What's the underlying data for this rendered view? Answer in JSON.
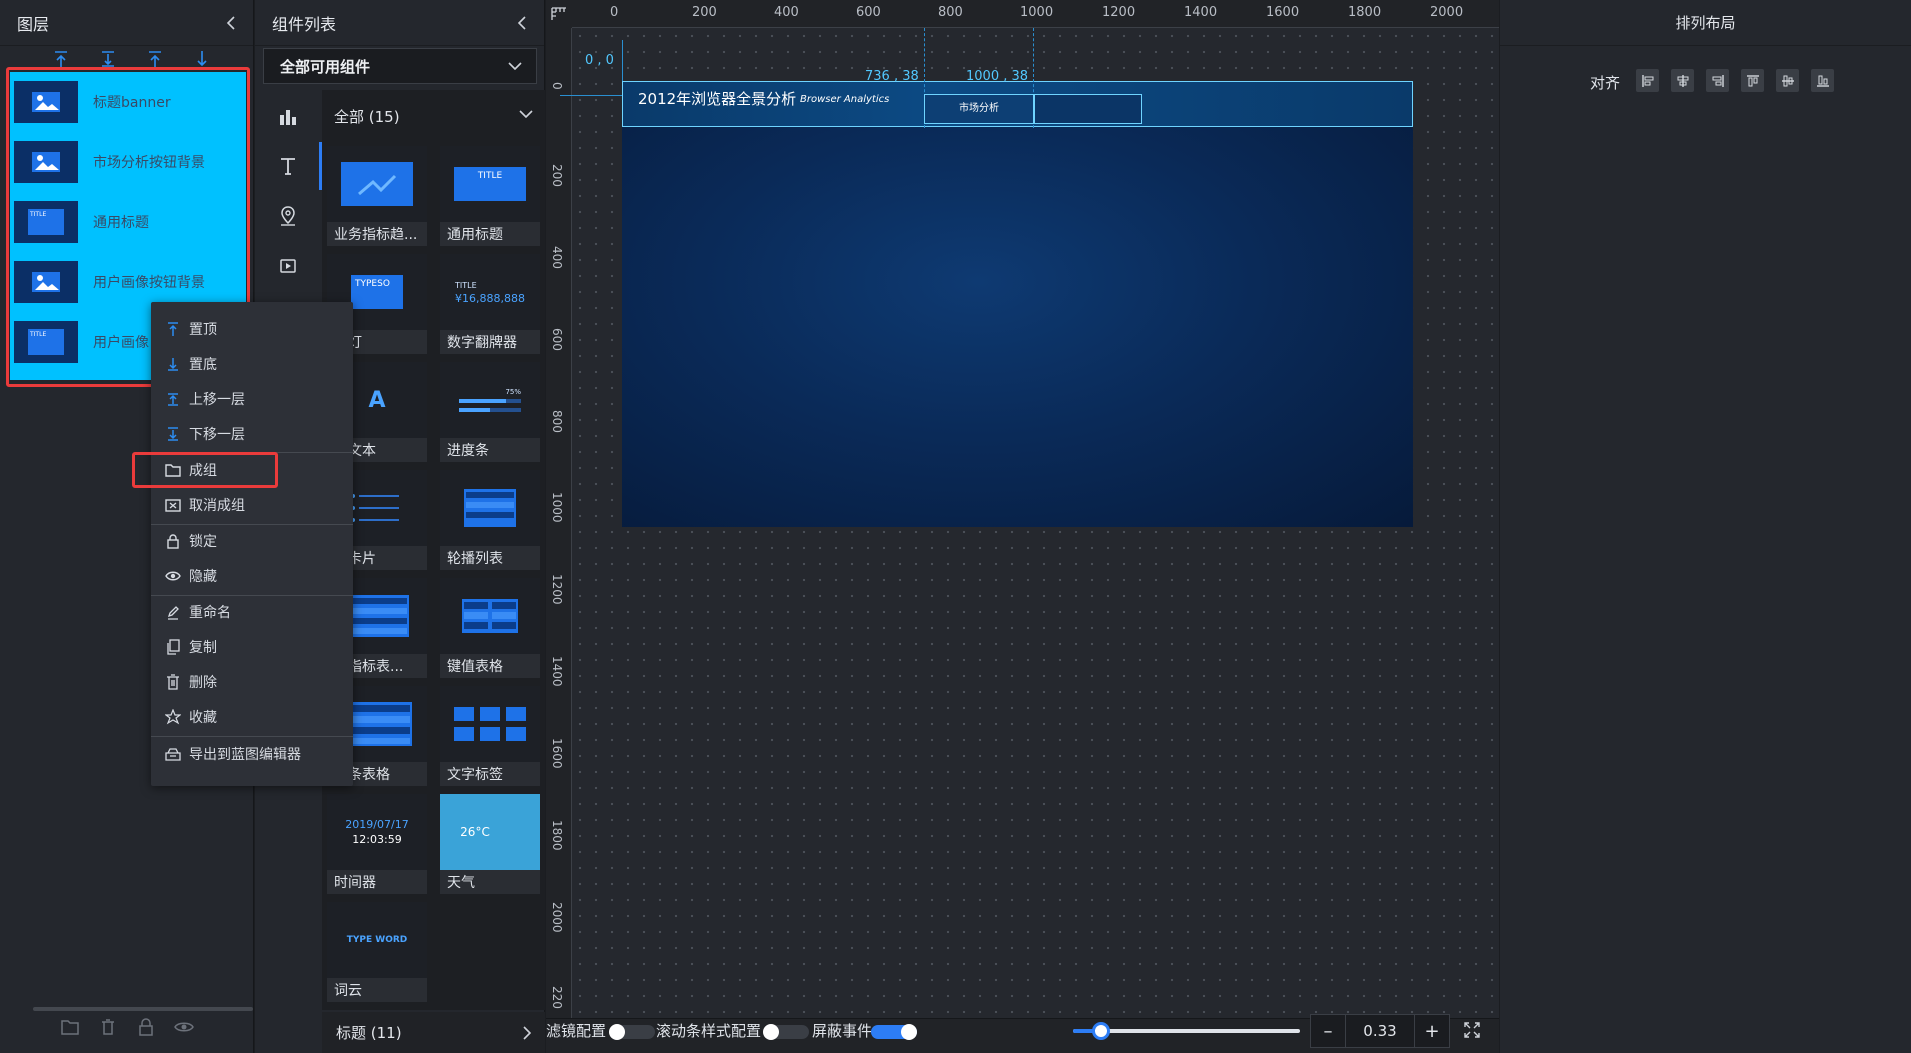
{
  "layers_panel": {
    "title": "图层",
    "items": [
      {
        "label": "标题banner",
        "thumb": "image"
      },
      {
        "label": "市场分析按钮背景",
        "thumb": "image"
      },
      {
        "label": "通用标题",
        "thumb": "title"
      },
      {
        "label": "用户画像按钮背景",
        "thumb": "image"
      },
      {
        "label": "用户画像",
        "thumb": "title"
      }
    ],
    "thumb_title_text": "TITLE"
  },
  "context_menu": {
    "items": [
      {
        "label": "置顶",
        "icon": "to-top-icon"
      },
      {
        "label": "置底",
        "icon": "to-bottom-icon"
      },
      {
        "label": "上移一层",
        "icon": "move-up-icon"
      },
      {
        "label": "下移一层",
        "icon": "move-down-icon"
      },
      {
        "label": "成组",
        "icon": "folder-icon"
      },
      {
        "label": "取消成组",
        "icon": "ungroup-icon"
      },
      {
        "label": "锁定",
        "icon": "lock-icon"
      },
      {
        "label": "隐藏",
        "icon": "eye-icon"
      },
      {
        "label": "重命名",
        "icon": "rename-icon"
      },
      {
        "label": "复制",
        "icon": "copy-icon"
      },
      {
        "label": "删除",
        "icon": "trash-icon"
      },
      {
        "label": "收藏",
        "icon": "star-icon"
      },
      {
        "label": "导出到蓝图编辑器",
        "icon": "export-icon"
      }
    ]
  },
  "component_panel": {
    "title": "组件列表",
    "filter_value": "全部可用组件",
    "group_all": "全部 (15)",
    "group_title": "标题 (11)",
    "components": [
      {
        "label": "业务指标趋...",
        "thumb_text": ""
      },
      {
        "label": "通用标题",
        "thumb_text": "TITLE"
      },
      {
        "label": "马灯",
        "thumb_text": "TYPESO"
      },
      {
        "label": "数字翻牌器",
        "thumb_text": "¥16,888,888"
      },
      {
        "label": "行文本",
        "thumb_text": "A"
      },
      {
        "label": "进度条",
        "thumb_text": "75%"
      },
      {
        "label": "态卡片",
        "thumb_text": ""
      },
      {
        "label": "轮播列表",
        "thumb_text": ""
      },
      {
        "label": "叠指标表...",
        "thumb_text": ""
      },
      {
        "label": "键值表格",
        "thumb_text": ""
      },
      {
        "label": "度条表格",
        "thumb_text": ""
      },
      {
        "label": "文字标签",
        "thumb_text": ""
      },
      {
        "label": "时间器",
        "thumb_text": "2019/07/17"
      },
      {
        "label": "天气",
        "thumb_text": "26°C"
      },
      {
        "label": "词云",
        "thumb_text": "TYPE WORD"
      }
    ],
    "timer_time": "12:03:59",
    "number_title": "TITLE"
  },
  "canvas": {
    "ruler_top": [
      "0",
      "200",
      "400",
      "600",
      "800",
      "1000",
      "1200",
      "1400",
      "1600",
      "1800",
      "2000"
    ],
    "ruler_left": [
      "0",
      "200",
      "400",
      "600",
      "800",
      "1000",
      "1200",
      "1400",
      "1600",
      "1800",
      "2000",
      "220"
    ],
    "origin_coord": "0 , 0",
    "coord_a": "736 , 38",
    "coord_b": "1000 , 38",
    "banner_title": "2012年浏览器全景分析",
    "banner_sub": "Browser Analytics",
    "button_label": "市场分析"
  },
  "bottom_bar": {
    "filter_config": "滤镜配置",
    "scroll_config": "滚动条样式配置",
    "mask_events": "屏蔽事件",
    "filter_on": false,
    "scroll_on": false,
    "mask_on": true,
    "zoom_minus": "–",
    "zoom_value": "0.33",
    "zoom_plus": "+",
    "zoom_level": 0.33
  },
  "right_panel": {
    "title": "排列布局",
    "align_label": "对齐"
  },
  "colors": {
    "accent": "#2d7df5",
    "layer_highlight": "#00c1ff",
    "selection_red": "#ea3b3b"
  }
}
